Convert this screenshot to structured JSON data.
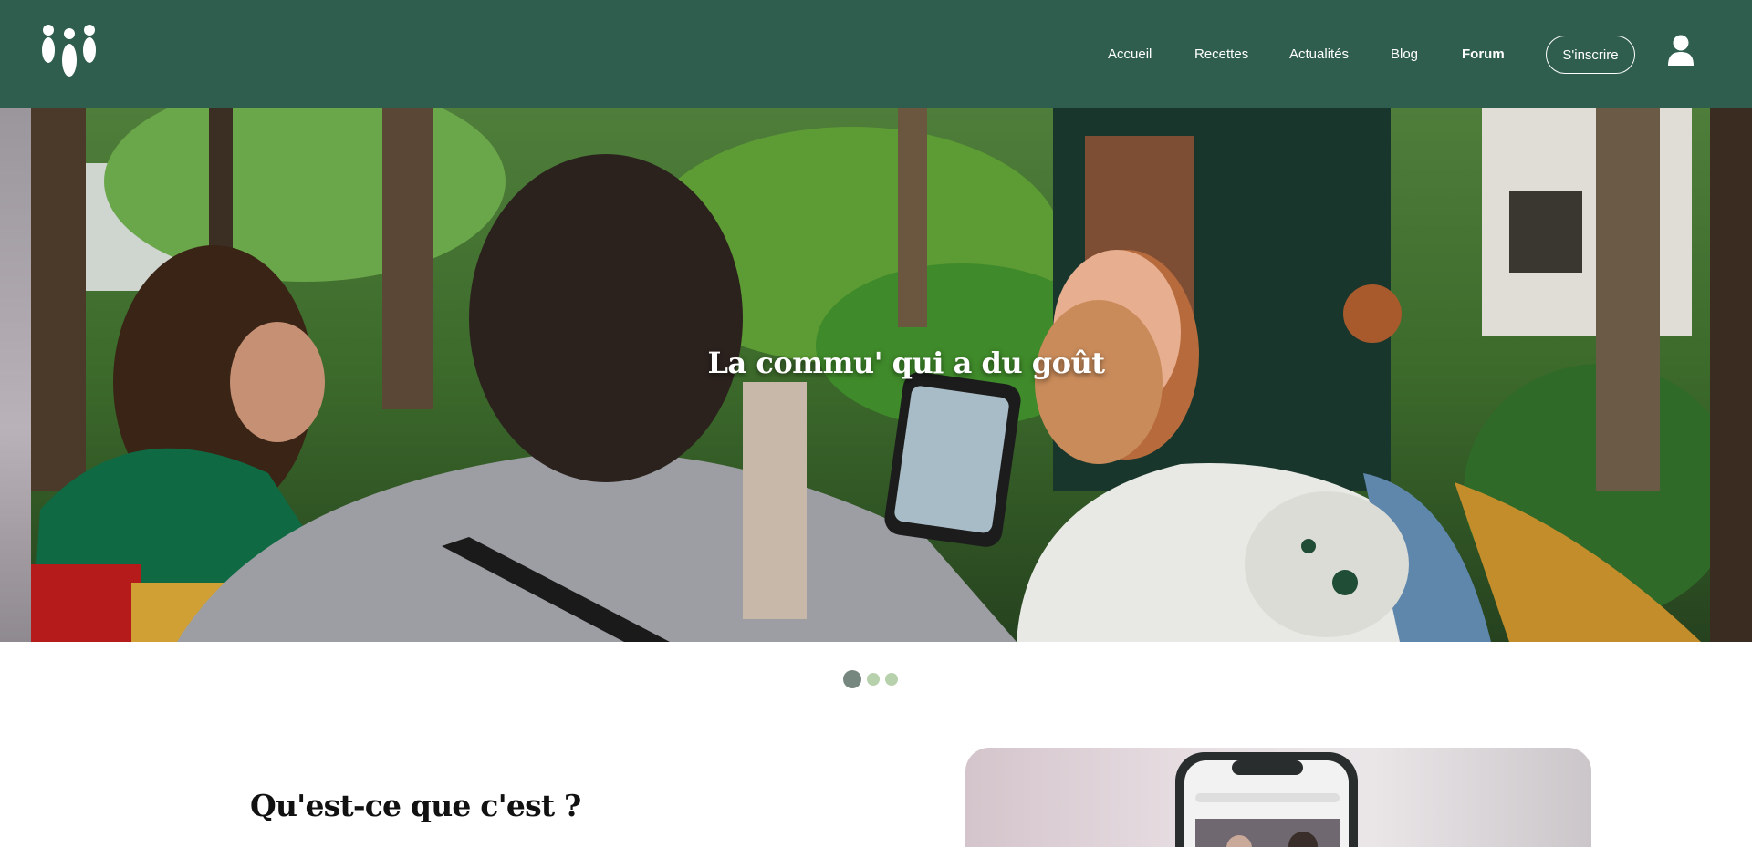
{
  "header": {
    "logo_name": "community-logo",
    "nav": [
      {
        "label": "Accueil",
        "active": false
      },
      {
        "label": "Recettes",
        "active": false
      },
      {
        "label": "Actualités",
        "active": false
      },
      {
        "label": "Blog",
        "active": false
      },
      {
        "label": "Forum",
        "active": true
      }
    ],
    "signup_label": "S'inscrire",
    "user_icon": "user-icon",
    "background_color": "#2f5e4f"
  },
  "hero": {
    "title": "La commu' qui a du goût",
    "slides_total": 3,
    "active_slide": 1
  },
  "about": {
    "title": "Qu'est-ce que c'est ?"
  },
  "colors": {
    "brand_green": "#2f5e4f",
    "dot_active": "#76877f",
    "dot_inactive": "#b7d1ac"
  }
}
